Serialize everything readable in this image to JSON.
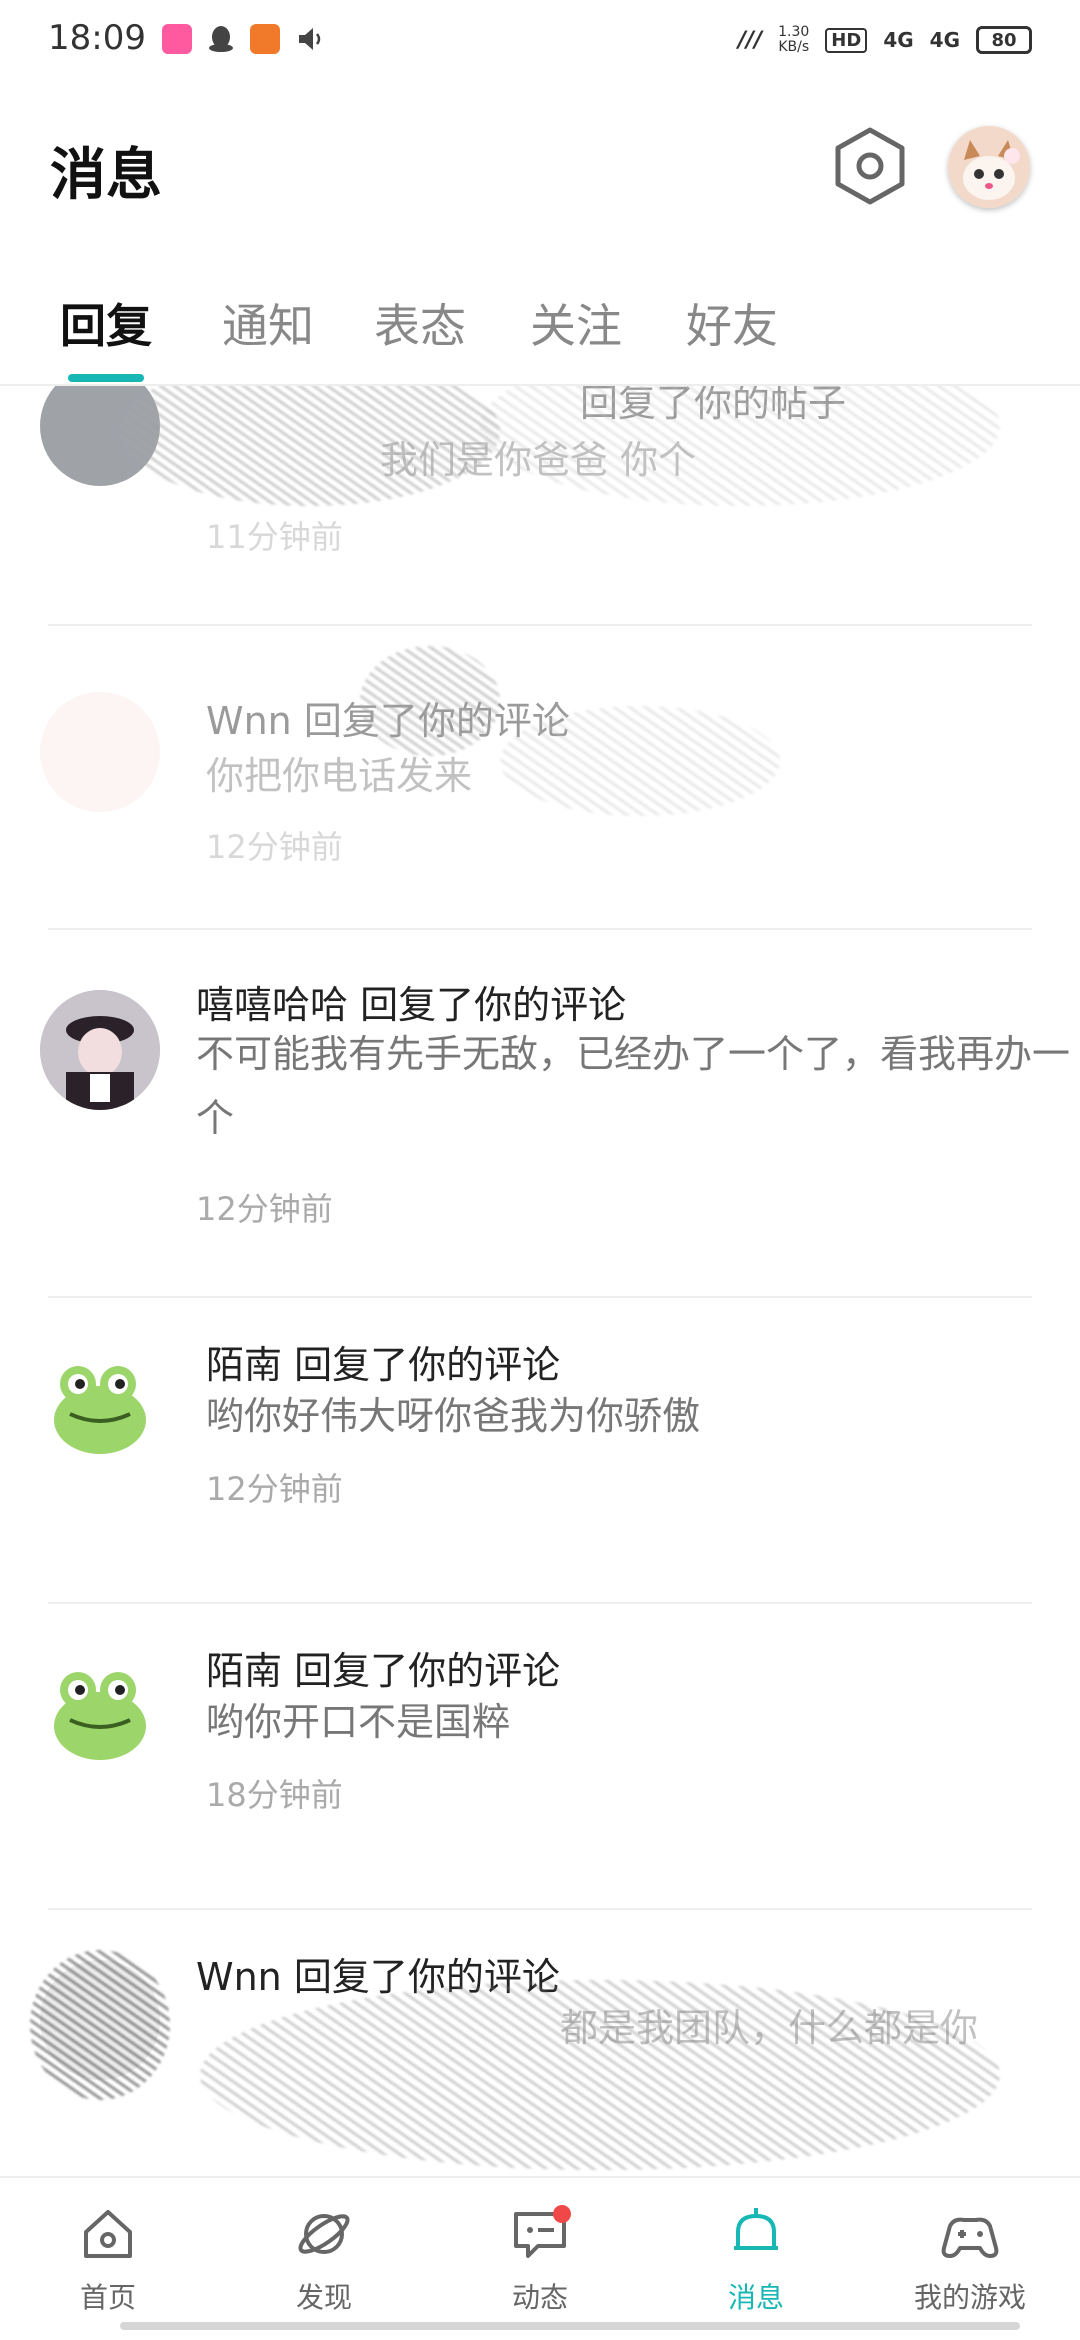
{
  "status_bar": {
    "time": "18:09",
    "net_speed_value": "1.30",
    "net_speed_unit": "KB/s",
    "hd": "HD",
    "signal_1": "4G",
    "signal_2": "4G",
    "battery": "80"
  },
  "header": {
    "title": "消息",
    "settings_icon": "hexagon-gear-icon",
    "avatar": "user-avatar"
  },
  "tabs": [
    {
      "label": "回复",
      "active": true
    },
    {
      "label": "通知",
      "active": false
    },
    {
      "label": "表态",
      "active": false
    },
    {
      "label": "关注",
      "active": false
    },
    {
      "label": "好友",
      "active": false
    }
  ],
  "messages": [
    {
      "title": "回复了你的帖子",
      "body": "我们是你爸爸 你个",
      "time": "11分钟前"
    },
    {
      "title": "Wnn 回复了你的评论",
      "body": "你把你电话发来",
      "time": "12分钟前"
    },
    {
      "title": "嘻嘻哈哈 回复了你的评论",
      "body": "不可能我有先手无敌，已经办了一个了，看我再办一个",
      "time": "12分钟前"
    },
    {
      "title": "陌南 回复了你的评论",
      "body": "哟你好伟大呀你爸我为你骄傲",
      "time": "12分钟前"
    },
    {
      "title": "陌南 回复了你的评论",
      "body": "哟你开口不是国粹",
      "time": "18分钟前"
    },
    {
      "title": "Wnn 回复了你的评论",
      "body": "都是我团队，什么都是你",
      "time": ""
    }
  ],
  "bottom_nav": [
    {
      "label": "首页",
      "icon": "home-icon",
      "active": false
    },
    {
      "label": "发现",
      "icon": "planet-icon",
      "active": false
    },
    {
      "label": "动态",
      "icon": "chat-bubble-icon",
      "active": false,
      "badge": true
    },
    {
      "label": "消息",
      "icon": "bell-icon",
      "active": true
    },
    {
      "label": "我的游戏",
      "icon": "gamepad-icon",
      "active": false
    }
  ],
  "colors": {
    "accent": "#17b7b5",
    "badge": "#f04848"
  }
}
